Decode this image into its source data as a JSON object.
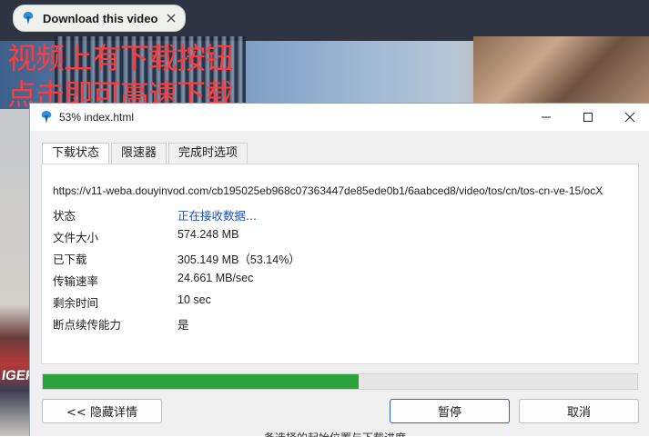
{
  "overlay": {
    "download_pill_label": "Download this video",
    "promo_line1": "视频上有下载按钮",
    "promo_line2": "点击即可高速下载",
    "sign_text": "IGER"
  },
  "window": {
    "title": "53% index.html"
  },
  "tabs": [
    {
      "label": "下载状态",
      "active": true
    },
    {
      "label": "限速器",
      "active": false
    },
    {
      "label": "完成时选项",
      "active": false
    }
  ],
  "details": {
    "url": "https://v11-weba.douyinvod.com/cb195025eb968c07363447de85ede0b1/6aabced8/video/tos/cn/tos-cn-ve-15/ocX",
    "rows": [
      {
        "key": "状态",
        "value": "正在接收数据..."
      },
      {
        "key": "文件大小",
        "value": "574.248 MB"
      },
      {
        "key": "已下载",
        "value": "305.149 MB（53.14%）"
      },
      {
        "key": "传输速率",
        "value": "24.661 MB/sec"
      },
      {
        "key": "剩余时间",
        "value": "10 sec"
      },
      {
        "key": "断点续传能力",
        "value": "是"
      }
    ]
  },
  "progress": {
    "percent": 53.14,
    "color": "#2ba33c"
  },
  "buttons": {
    "details": "<< 隐藏详情",
    "pause": "暂停",
    "cancel": "取消"
  },
  "footer_text": "备选择的起始位置与下载进度",
  "colors": {
    "promo": "#ff3b3b",
    "link": "#1f4fb4",
    "accent": "#2a64c5"
  }
}
